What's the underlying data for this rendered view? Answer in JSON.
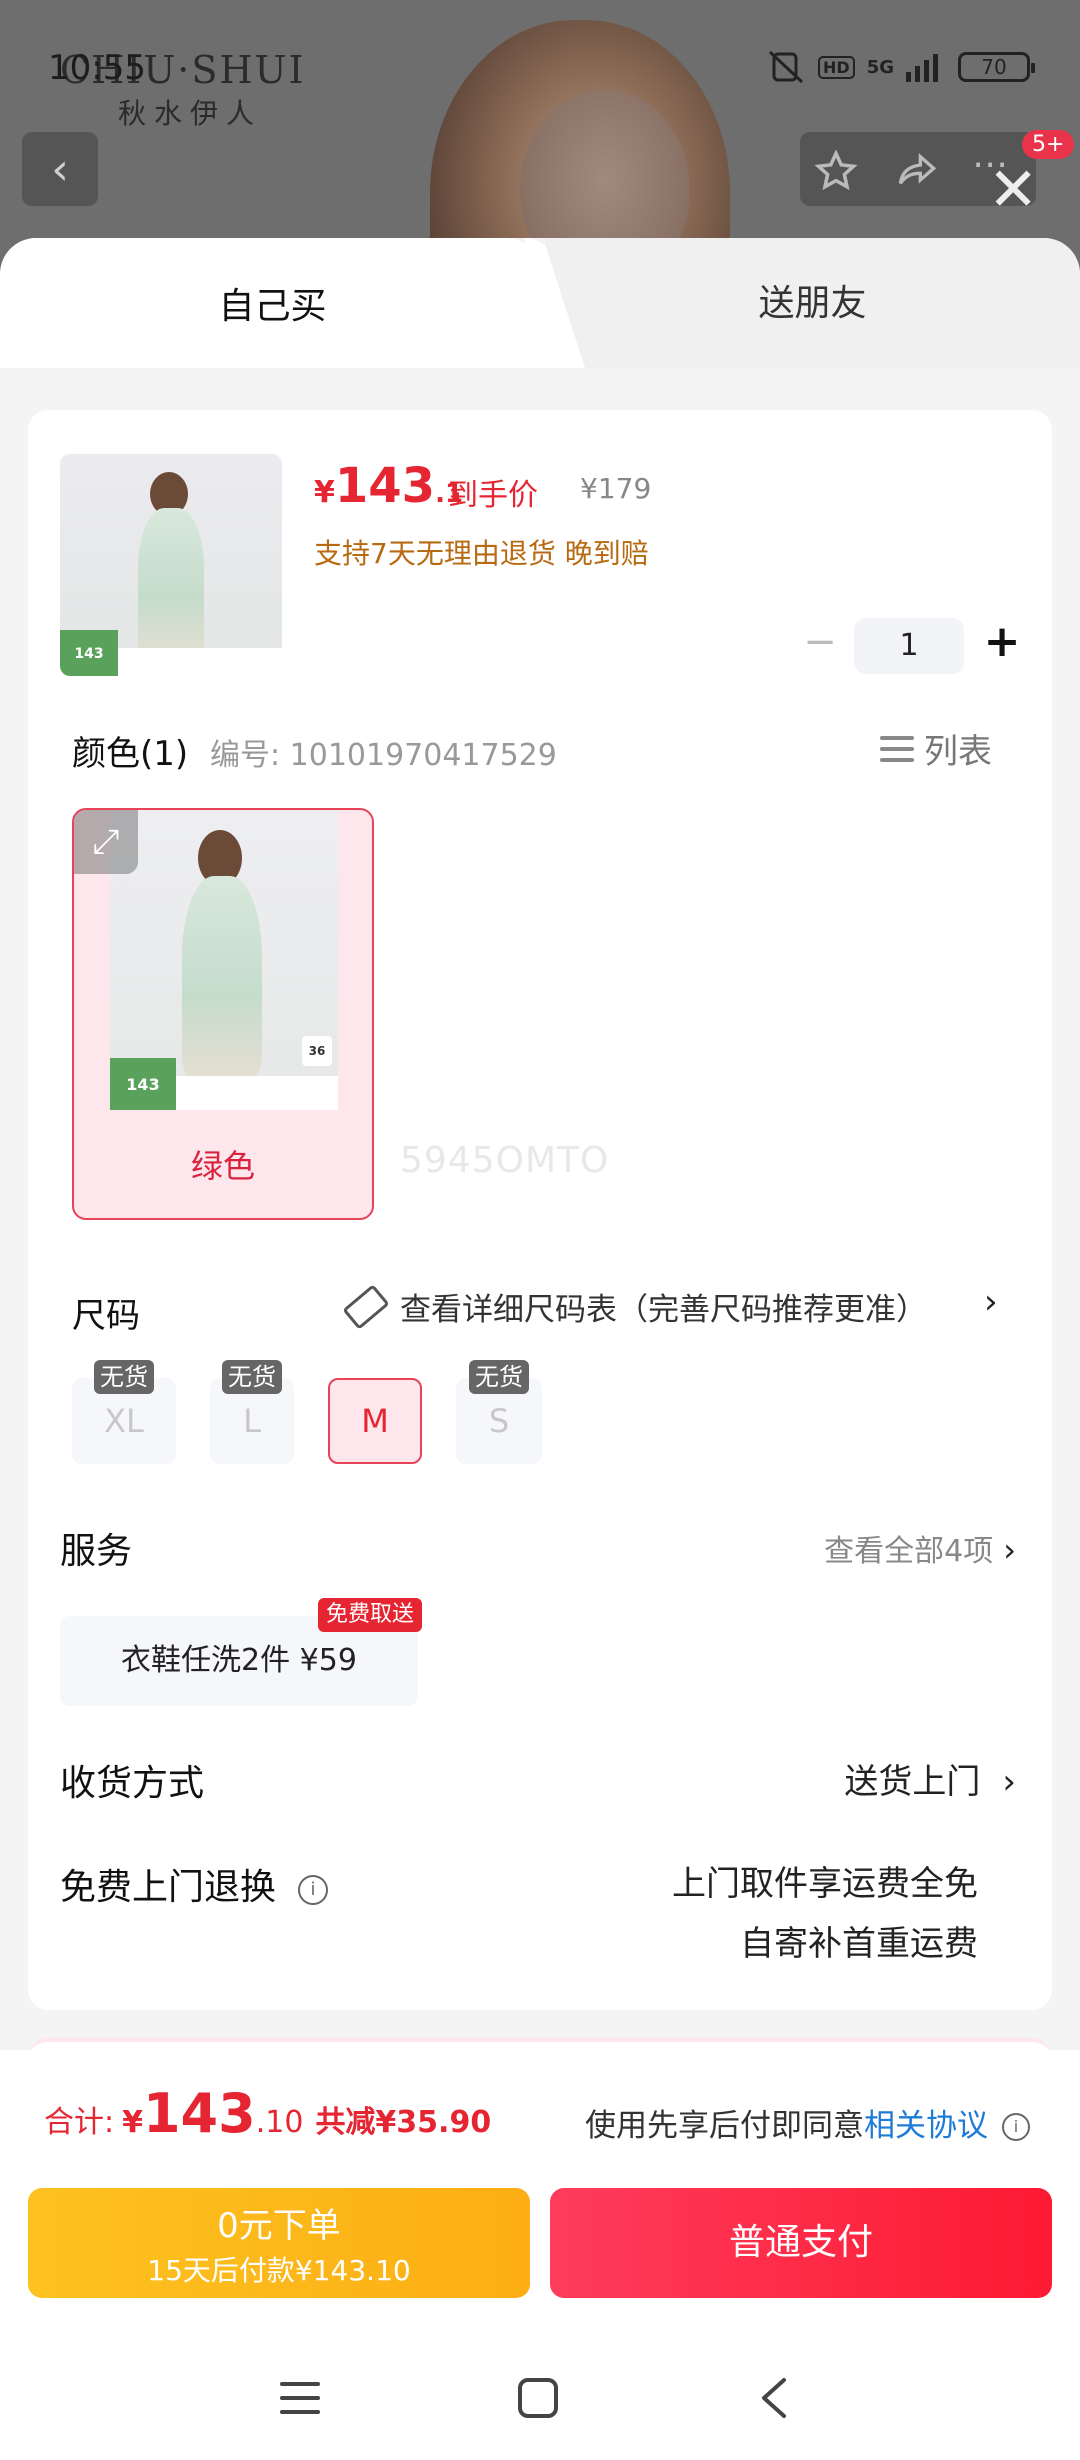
{
  "status_bar": {
    "time": "10:55",
    "network": "5G",
    "hd_label": "HD",
    "battery": "70"
  },
  "header": {
    "brand_en": "CHIU·SHUI",
    "brand_cn": "秋水伊人",
    "cart_badge": "5+"
  },
  "tabs": [
    {
      "label": "自己买",
      "active": true
    },
    {
      "label": "送朋友",
      "active": false
    }
  ],
  "product": {
    "price_symbol": "¥",
    "price_int": "143",
    "price_dec": ".1",
    "price_label": "到手价",
    "original_price": "¥179",
    "policy": "支持7天无理由退货  晚到赔",
    "thumb_price": "143"
  },
  "quantity": {
    "minus": "−",
    "value": "1",
    "plus": "+"
  },
  "color": {
    "title": "颜色(1)",
    "code": "编号: 10101970417529",
    "list_label": "列表",
    "options": [
      {
        "label": "绿色",
        "selected": true,
        "img_price": "143",
        "img_size": "36"
      }
    ],
    "watermark": "5945OMTO"
  },
  "size": {
    "title": "尺码",
    "chart_link": "查看详细尺码表（完善尺码推荐更准）",
    "oos_label": "无货",
    "options": [
      {
        "label": "XL",
        "available": false
      },
      {
        "label": "L",
        "available": false
      },
      {
        "label": "M",
        "available": true,
        "selected": true
      },
      {
        "label": "S",
        "available": false
      }
    ]
  },
  "service": {
    "title": "服务",
    "view_all": "查看全部4项",
    "item": "衣鞋任洗2件  ¥59",
    "free_tag": "免费取送"
  },
  "delivery": {
    "title": "收货方式",
    "value": "送货上门"
  },
  "returns": {
    "title": "免费上门退换",
    "line1": "上门取件享运费全免",
    "line2": "自寄补首重运费"
  },
  "footer": {
    "total_label": "合计:",
    "total_symbol": "¥",
    "total_int": "143",
    "total_dec": ".10",
    "saved": "共减¥35.90",
    "agree_prefix": "使用先享后付即同意",
    "agree_link": "相关协议",
    "later_line1": "0元下单",
    "later_line2": "15天后付款¥143.10",
    "pay_label": "普通支付"
  },
  "colors": {
    "accent_red": "#e52531",
    "pay_button": "#fd1a32",
    "later_button": "#fcae14",
    "link_blue": "#1e7bd8",
    "policy_orange": "#b86a12"
  }
}
